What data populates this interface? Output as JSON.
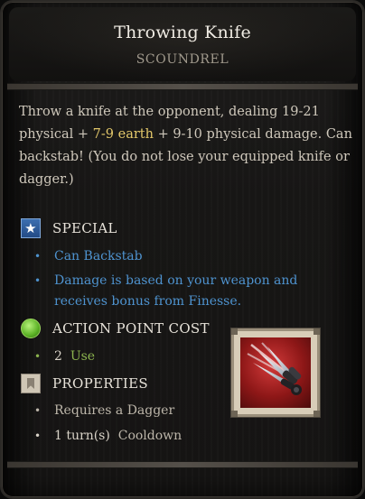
{
  "tooltip": {
    "title": "Throwing Knife",
    "school": "SCOUNDREL",
    "description": {
      "part1": "Throw a knife at the opponent, dealing 19-21 physical + ",
      "earth_damage": "7-9 earth",
      "part2": " + 9-10 physical damage. Can backstab! (You do not lose your equipped knife or dagger.)"
    },
    "special": {
      "heading": "SPECIAL",
      "icon": "star-icon",
      "items": [
        "Can Backstab",
        "Damage is based on your weapon and receives bonus from Finesse."
      ]
    },
    "action_point_cost": {
      "heading": "ACTION POINT COST",
      "icon": "green-orb-icon",
      "value": "2",
      "unit": "Use"
    },
    "properties": {
      "heading": "PROPERTIES",
      "icon": "bookmark-icon",
      "requirement": "Requires a Dagger",
      "cooldown_value": "1 turn(s)",
      "cooldown_label": "Cooldown"
    },
    "skill_icon": "throwing-knives-skill-icon",
    "colors": {
      "special_text": "#4e93cf",
      "earth_text": "#e3c86a",
      "ap_text": "#8bb34e",
      "body_text": "#cfc8bb"
    }
  }
}
